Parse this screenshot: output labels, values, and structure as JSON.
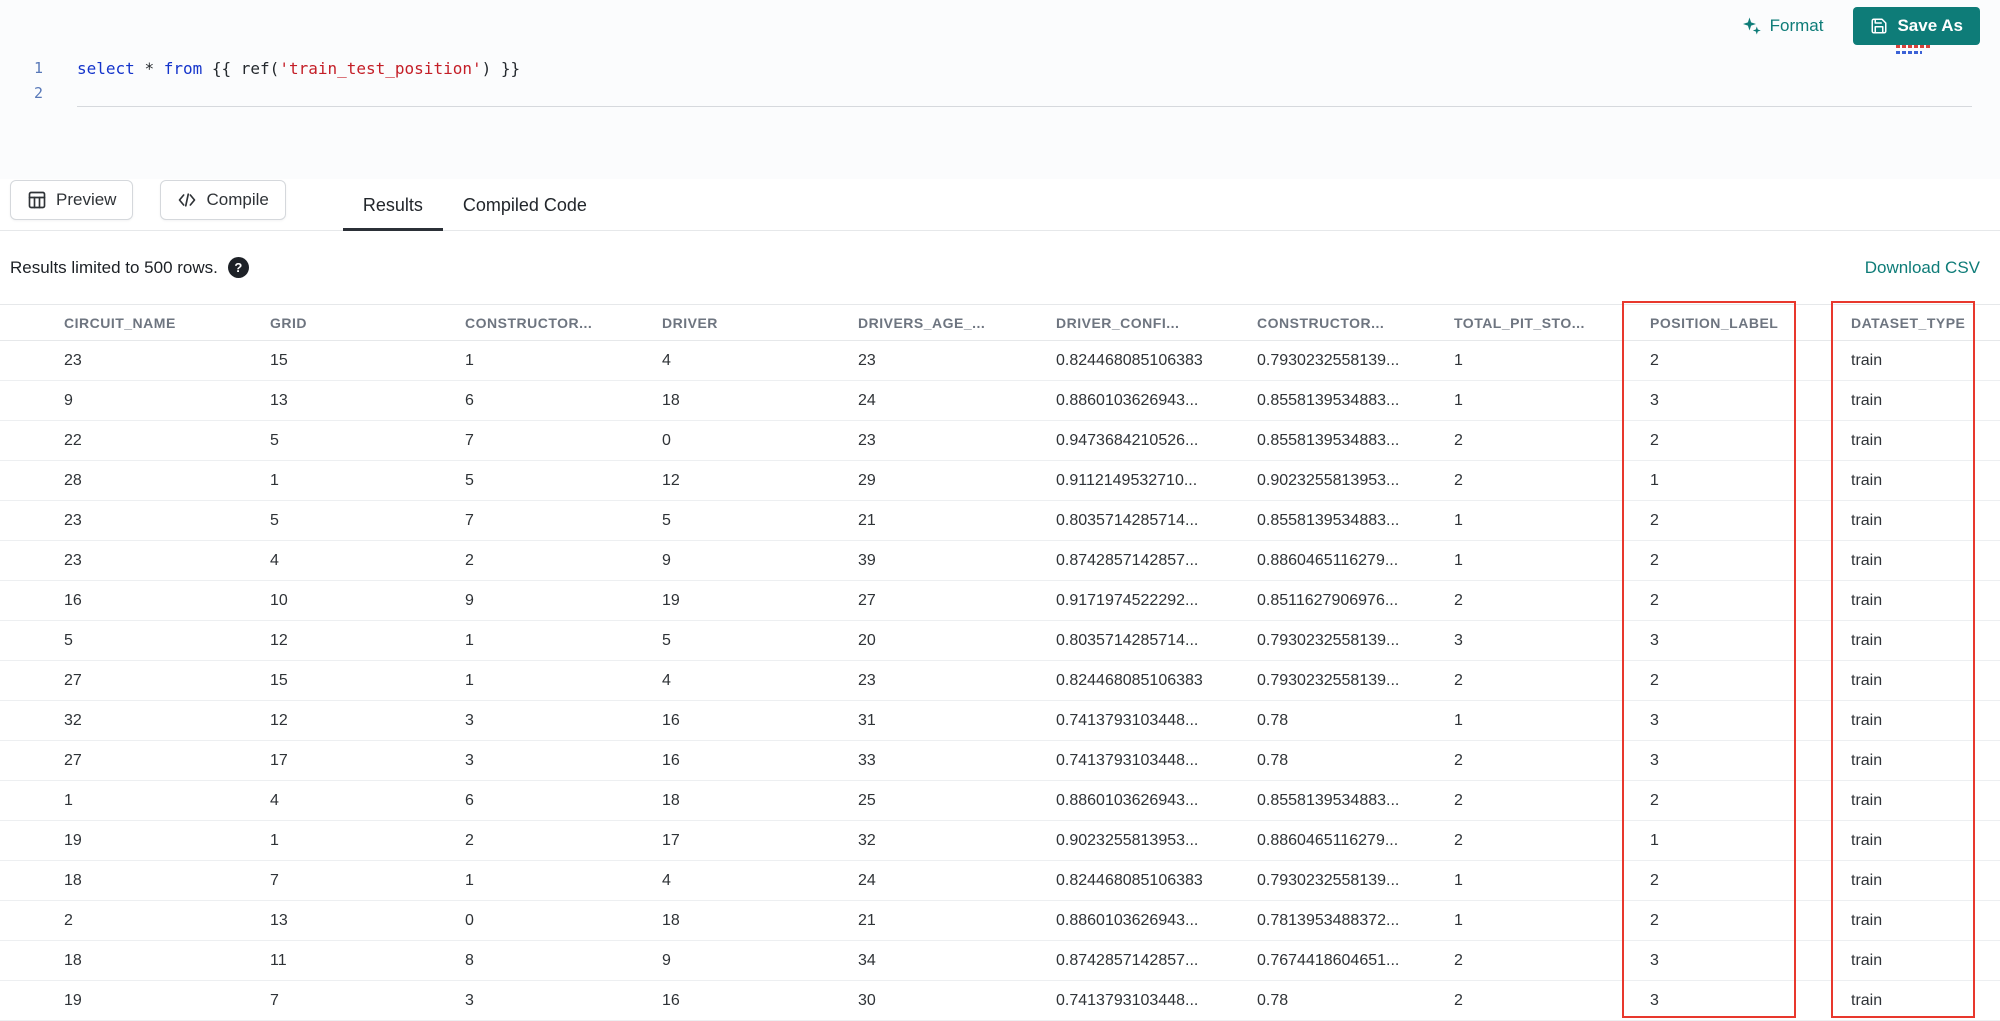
{
  "theme": {
    "accent_teal": "#0E7C78",
    "highlight_red": "#E8382D"
  },
  "toolbar": {
    "format_label": "Format",
    "save_as_label": "Save As"
  },
  "editor": {
    "line_numbers": [
      "1",
      "2"
    ],
    "code_tokens": [
      {
        "text": "select",
        "type": "keyword"
      },
      {
        "text": " ",
        "type": "plain"
      },
      {
        "text": "*",
        "type": "operator"
      },
      {
        "text": " ",
        "type": "plain"
      },
      {
        "text": "from",
        "type": "keyword"
      },
      {
        "text": " {{ ",
        "type": "plain"
      },
      {
        "text": "ref(",
        "type": "plain"
      },
      {
        "text": "'train_test_position'",
        "type": "string"
      },
      {
        "text": ") }}",
        "type": "plain"
      }
    ]
  },
  "actions": {
    "preview_label": "Preview",
    "compile_label": "Compile"
  },
  "tabs": [
    {
      "label": "Results",
      "active": true
    },
    {
      "label": "Compiled Code",
      "active": false
    }
  ],
  "results": {
    "limit_note": "Results limited to 500 rows.",
    "help_glyph": "?",
    "download_csv_label": "Download CSV",
    "highlighted_columns": [
      "POSITION_LABEL",
      "DATASET_TYPE"
    ],
    "columns": [
      "CIRCUIT_NAME",
      "GRID",
      "CONSTRUCTOR...",
      "DRIVER",
      "DRIVERS_AGE_...",
      "DRIVER_CONFI...",
      "CONSTRUCTOR...",
      "TOTAL_PIT_STO...",
      "POSITION_LABEL",
      "DATASET_TYPE"
    ],
    "rows": [
      [
        "23",
        "15",
        "1",
        "4",
        "23",
        "0.824468085106383",
        "0.7930232558139...",
        "1",
        "2",
        "train"
      ],
      [
        "9",
        "13",
        "6",
        "18",
        "24",
        "0.8860103626943...",
        "0.8558139534883...",
        "1",
        "3",
        "train"
      ],
      [
        "22",
        "5",
        "7",
        "0",
        "23",
        "0.9473684210526...",
        "0.8558139534883...",
        "2",
        "2",
        "train"
      ],
      [
        "28",
        "1",
        "5",
        "12",
        "29",
        "0.9112149532710...",
        "0.9023255813953...",
        "2",
        "1",
        "train"
      ],
      [
        "23",
        "5",
        "7",
        "5",
        "21",
        "0.8035714285714...",
        "0.8558139534883...",
        "1",
        "2",
        "train"
      ],
      [
        "23",
        "4",
        "2",
        "9",
        "39",
        "0.8742857142857...",
        "0.8860465116279...",
        "1",
        "2",
        "train"
      ],
      [
        "16",
        "10",
        "9",
        "19",
        "27",
        "0.9171974522292...",
        "0.8511627906976...",
        "2",
        "2",
        "train"
      ],
      [
        "5",
        "12",
        "1",
        "5",
        "20",
        "0.8035714285714...",
        "0.7930232558139...",
        "3",
        "3",
        "train"
      ],
      [
        "27",
        "15",
        "1",
        "4",
        "23",
        "0.824468085106383",
        "0.7930232558139...",
        "2",
        "2",
        "train"
      ],
      [
        "32",
        "12",
        "3",
        "16",
        "31",
        "0.7413793103448...",
        "0.78",
        "1",
        "3",
        "train"
      ],
      [
        "27",
        "17",
        "3",
        "16",
        "33",
        "0.7413793103448...",
        "0.78",
        "2",
        "3",
        "train"
      ],
      [
        "1",
        "4",
        "6",
        "18",
        "25",
        "0.8860103626943...",
        "0.8558139534883...",
        "2",
        "2",
        "train"
      ],
      [
        "19",
        "1",
        "2",
        "17",
        "32",
        "0.9023255813953...",
        "0.8860465116279...",
        "2",
        "1",
        "train"
      ],
      [
        "18",
        "7",
        "1",
        "4",
        "24",
        "0.824468085106383",
        "0.7930232558139...",
        "1",
        "2",
        "train"
      ],
      [
        "2",
        "13",
        "0",
        "18",
        "21",
        "0.8860103626943...",
        "0.7813953488372...",
        "1",
        "2",
        "train"
      ],
      [
        "18",
        "11",
        "8",
        "9",
        "34",
        "0.8742857142857...",
        "0.7674418604651...",
        "2",
        "3",
        "train"
      ],
      [
        "19",
        "7",
        "3",
        "16",
        "30",
        "0.7413793103448...",
        "0.78",
        "2",
        "3",
        "train"
      ]
    ]
  }
}
